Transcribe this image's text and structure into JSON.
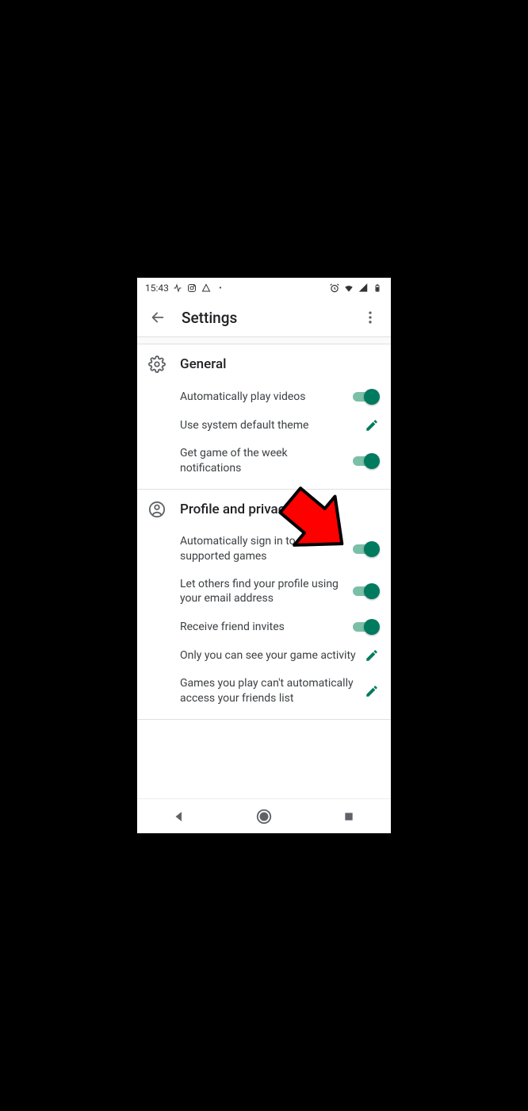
{
  "status": {
    "time": "15:43",
    "icons_left": [
      "activity",
      "instagram",
      "triangle-lines",
      "dot"
    ],
    "icons_right": [
      "alarm",
      "wifi",
      "signal",
      "battery"
    ]
  },
  "appbar": {
    "title": "Settings"
  },
  "sections": {
    "general": {
      "title": "General",
      "items": {
        "auto_videos": "Automatically play videos",
        "system_theme": "Use system default theme",
        "game_week": "Get game of the week notifications"
      }
    },
    "profile": {
      "title": "Profile and privacy",
      "items": {
        "auto_signin": "Automatically sign in to supported games",
        "find_email": "Let others find your profile using your email address",
        "friend_invites": "Receive friend invites",
        "game_activity": "Only you can see your game activity",
        "friends_list": "Games you play can't automatically access your friends list"
      }
    }
  }
}
